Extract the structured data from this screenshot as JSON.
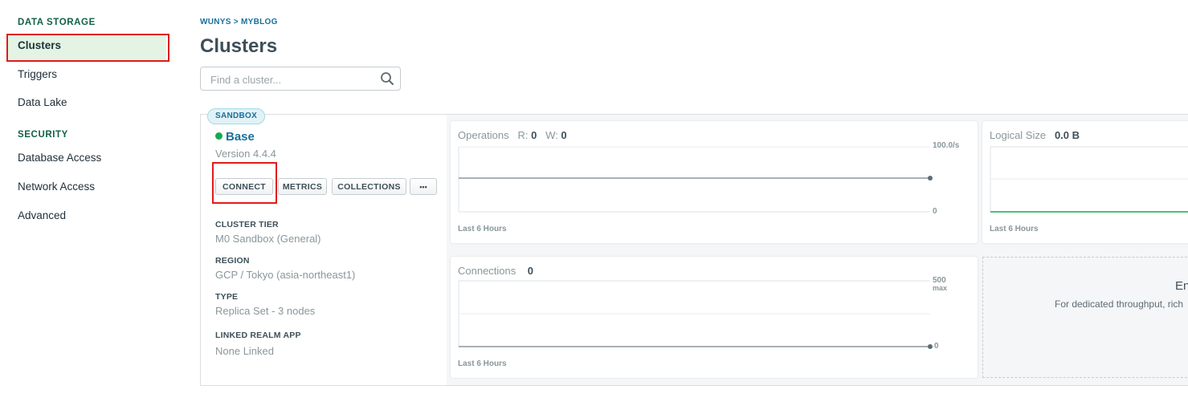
{
  "sidebar": {
    "data_storage_heading": "DATA STORAGE",
    "clusters": "Clusters",
    "triggers": "Triggers",
    "data_lake": "Data Lake",
    "security_heading": "SECURITY",
    "database_access": "Database Access",
    "network_access": "Network Access",
    "advanced": "Advanced"
  },
  "breadcrumb": "WUNYS > MYBLOG",
  "page_title": "Clusters",
  "search": {
    "placeholder": "Find a cluster..."
  },
  "cluster": {
    "badge": "SANDBOX",
    "name": "Base",
    "status_color": "#13aa52",
    "version": "Version 4.4.4",
    "buttons": {
      "connect": "CONNECT",
      "metrics": "METRICS",
      "collections": "COLLECTIONS",
      "more": "•••"
    },
    "details": [
      {
        "label": "CLUSTER TIER",
        "value": "M0 Sandbox (General)"
      },
      {
        "label": "REGION",
        "value": "GCP / Tokyo (asia-northeast1)"
      },
      {
        "label": "TYPE",
        "value": "Replica Set - 3 nodes"
      },
      {
        "label": "LINKED REALM APP",
        "value": "None Linked"
      }
    ]
  },
  "operations": {
    "title": "Operations",
    "r_label": "R:",
    "r_value": "0",
    "w_label": "W:",
    "w_value": "0",
    "y_max": "100.0/s",
    "y_min": "0",
    "footer": "Last 6 Hours"
  },
  "logical_size": {
    "title": "Logical Size",
    "value": "0.0 B",
    "footer": "Last 6 Hours",
    "line_color": "#13aa52"
  },
  "connections": {
    "title": "Connections",
    "value": "0",
    "y_max": "500",
    "y_max_sub": "max",
    "y_min": "0",
    "footer": "Last 6 Hours"
  },
  "upsell": {
    "title": "En",
    "text": "For dedicated throughput, rich"
  },
  "highlight_color": "#e01b1b"
}
